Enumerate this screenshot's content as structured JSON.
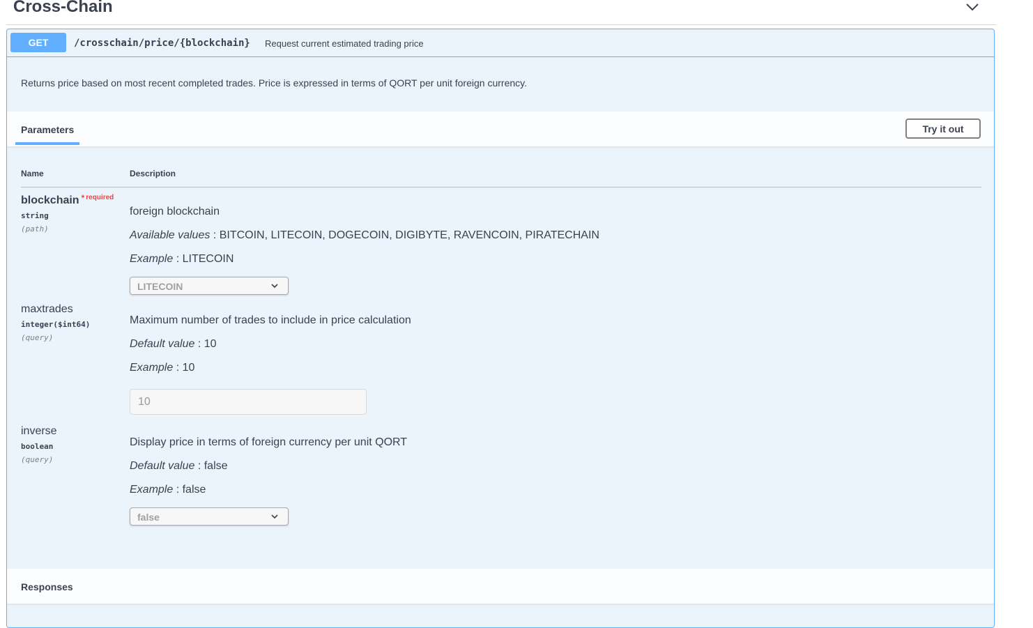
{
  "section": {
    "title": "Cross-Chain",
    "toggle_icon": "chevron-down-icon"
  },
  "operation": {
    "method": "GET",
    "path": "/crosschain/price/{blockchain}",
    "summary": "Request current estimated trading price",
    "description": "Returns price based on most recent completed trades. Price is expressed in terms of QORT per unit foreign currency.",
    "accent_color": "#61affe"
  },
  "parameters_tab": {
    "label": "Parameters",
    "try_button": "Try it out",
    "col_name": "Name",
    "col_description": "Description"
  },
  "params": [
    {
      "name": "blockchain",
      "required_star": "*",
      "required_text": "required",
      "type": "string",
      "in": "(path)",
      "description": "foreign blockchain",
      "available_label": "Available values",
      "available_values": ": BITCOIN, LITECOIN, DOGECOIN, DIGIBYTE, RAVENCOIN, PIRATECHAIN",
      "example_label": "Example",
      "example_value": ": LITECOIN",
      "selected": "LITECOIN"
    },
    {
      "name": "maxtrades",
      "type": "integer($int64)",
      "in": "(query)",
      "description": "Maximum number of trades to include in price calculation",
      "default_label": "Default value",
      "default_value": ": 10",
      "example_label": "Example",
      "example_value": ": 10",
      "input_value": "10"
    },
    {
      "name": "inverse",
      "type": "boolean",
      "in": "(query)",
      "description": "Display price in terms of foreign currency per unit QORT",
      "default_label": "Default value",
      "default_value": ": false",
      "example_label": "Example",
      "example_value": ": false",
      "selected": "false"
    }
  ],
  "responses": {
    "label": "Responses"
  }
}
